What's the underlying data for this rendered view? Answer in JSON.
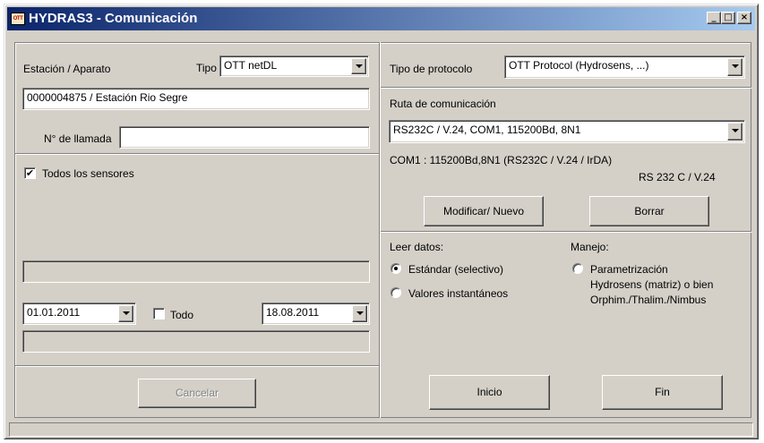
{
  "window": {
    "title": "HYDRAS3 - Comunicación",
    "app_icon_text": "OTT",
    "minimize": "_",
    "maximize": "□",
    "close": "×"
  },
  "station": {
    "label": "Estación / Aparato",
    "tipo_label": "Tipo",
    "tipo_value": "OTT netDL",
    "station_value": "0000004875 / Estación Rio Segre",
    "call_number_label": "N° de llamada",
    "call_number_value": ""
  },
  "sensors": {
    "all_sensors_label": "Todos los sensores",
    "all_sensors_checked": true
  },
  "range": {
    "start_date": "01.01.2011",
    "todo_label": "Todo",
    "todo_checked": false,
    "end_date": "18.08.2011"
  },
  "protocol": {
    "label": "Tipo de protocolo",
    "value": "OTT Protocol  (Hydrosens, ...)"
  },
  "route": {
    "label": "Ruta de comunicación",
    "value": "RS232C / V.24,  COM1,  115200Bd, 8N1",
    "info_line": "COM1 :  115200Bd,8N1  (RS232C / V.24 / IrDA)",
    "info_right": "RS 232 C / V.24",
    "modify_button": "Modificar/ Nuevo",
    "delete_button": "Borrar"
  },
  "read": {
    "label": "Leer datos:",
    "option_standard": "Estándar (selectivo)",
    "option_instant": "Valores instantáneos",
    "selected": "standard"
  },
  "handling": {
    "label": "Manejo:",
    "option_line1": "Parametrización",
    "option_line2": "Hydrosens (matriz) o bien",
    "option_line3": "Orphim./Thalim./Nimbus"
  },
  "buttons": {
    "cancel": "Cancelar",
    "start": "Inicio",
    "end": "Fin"
  }
}
